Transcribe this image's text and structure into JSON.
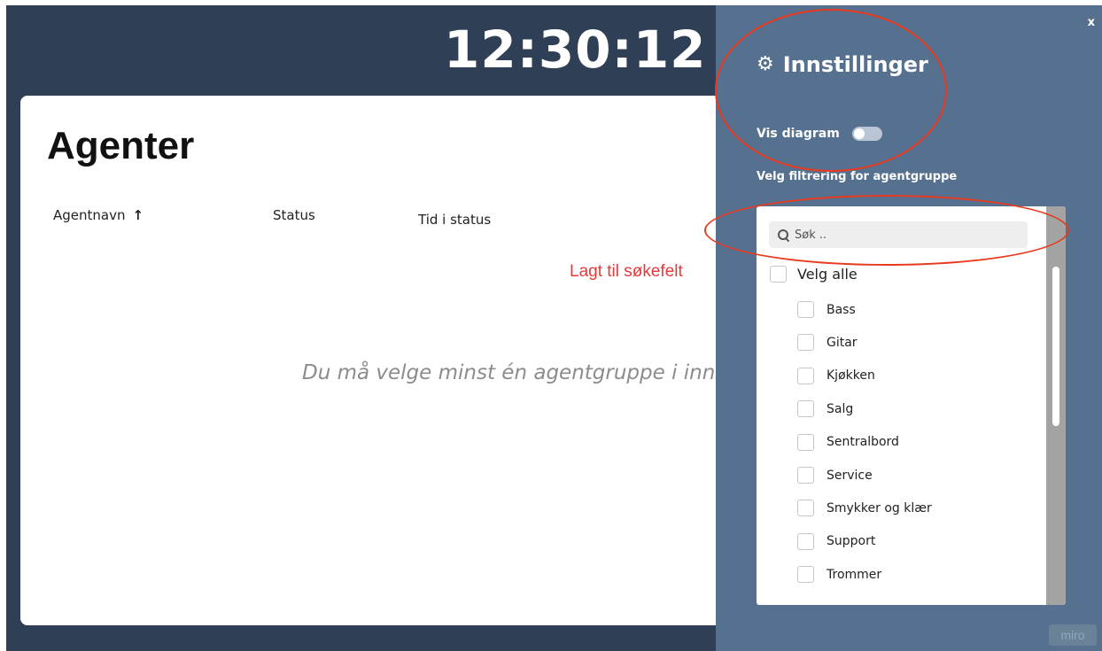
{
  "clock": {
    "time": "12:30:12"
  },
  "agents": {
    "title": "Agenter",
    "columns": [
      "Agentnavn",
      "Status",
      "Tid i status"
    ],
    "sort_indicator": "↑",
    "empty_message": "Du må velge minst én agentgruppe i innstillingene"
  },
  "annotation": {
    "text": "Lagt til søkefelt",
    "color": "#e6393a"
  },
  "settings": {
    "close_label": "x",
    "title": "Innstillinger",
    "title_icon": "gear-icon",
    "toggle_label": "Vis diagram",
    "toggle_on": false,
    "filter_label": "Velg filtrering for agentgruppe",
    "search_placeholder": "Søk ..",
    "select_all_label": "Velg alle",
    "groups": [
      "Bass",
      "Gitar",
      "Kjøkken",
      "Salg",
      "Sentralbord",
      "Service",
      "Smykker og klær",
      "Support",
      "Trommer"
    ]
  },
  "watermark": {
    "text": "miro"
  },
  "colors": {
    "background": "#2f4056",
    "panel": "#56708f",
    "highlight": "#e8391e"
  }
}
